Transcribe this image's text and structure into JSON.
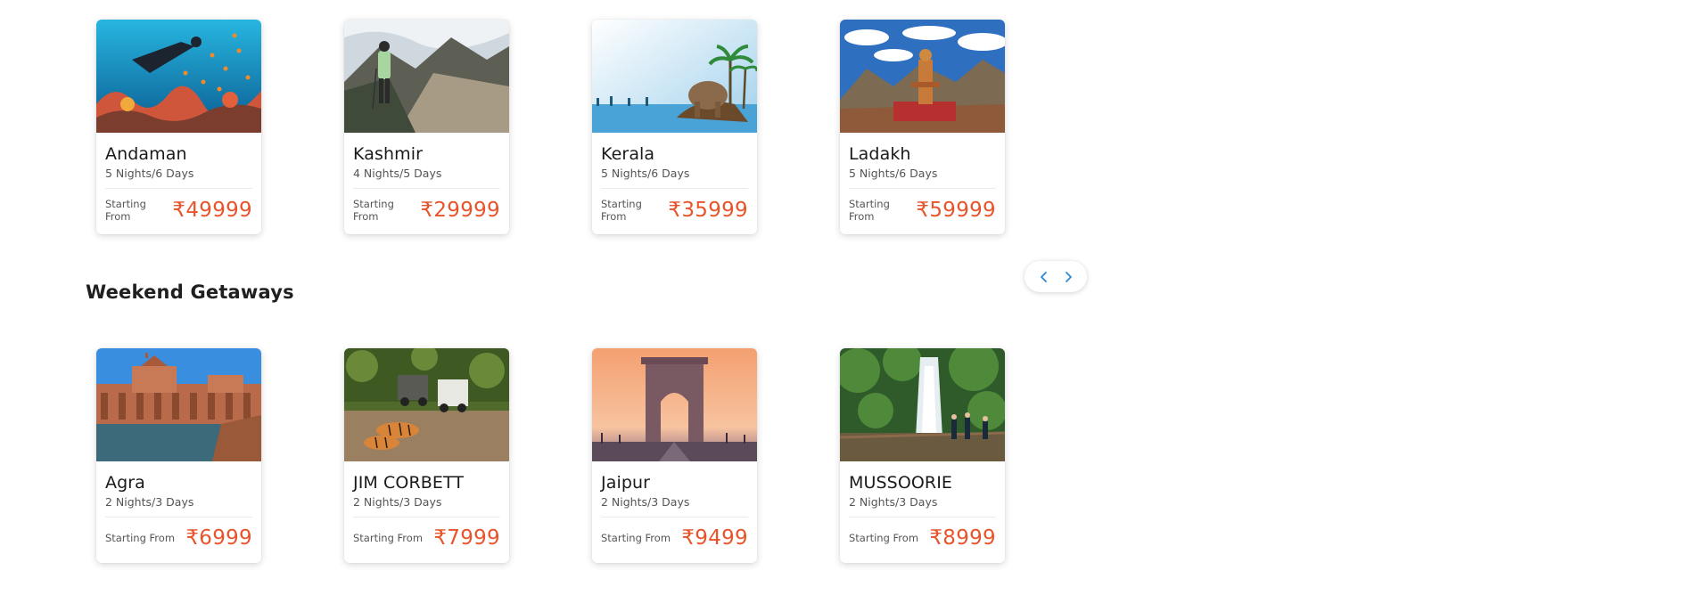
{
  "top_packages": [
    {
      "name": "Andaman",
      "duration": "5 Nights/6 Days",
      "price_label": "Starting From",
      "price": "₹49999",
      "image": "scuba-diving-reef"
    },
    {
      "name": "Kashmir",
      "duration": "4 Nights/5 Days",
      "price_label": "Starting From",
      "price": "₹29999",
      "image": "mountain-trekker"
    },
    {
      "name": "Kerala",
      "duration": "5 Nights/6 Days",
      "price_label": "Starting From",
      "price": "₹35999",
      "image": "elephant-palms-backwaters"
    },
    {
      "name": "Ladakh",
      "duration": "5 Nights/6 Days",
      "price_label": "Starting From",
      "price": "₹59999",
      "image": "statue-mountains"
    }
  ],
  "weekend_section": {
    "title": "Weekend Getaways",
    "packages": [
      {
        "name": "Agra",
        "duration": "2 Nights/3 Days",
        "price_label": "Starting From",
        "price": "₹6999",
        "image": "fatehpur-sikri"
      },
      {
        "name": "JIM CORBETT",
        "duration": "2 Nights/3 Days",
        "price_label": "Starting From",
        "price": "₹7999",
        "image": "tigers-jeeps"
      },
      {
        "name": "Jaipur",
        "duration": "2 Nights/3 Days",
        "price_label": "Starting From",
        "price": "₹9499",
        "image": "india-gate-sunset"
      },
      {
        "name": "MUSSOORIE",
        "duration": "2 Nights/3 Days",
        "price_label": "Starting From",
        "price": "₹8999",
        "image": "waterfall-forest"
      }
    ]
  },
  "carousel_nav": {
    "prev_icon": "chevron-left-icon",
    "next_icon": "chevron-right-icon",
    "color": "#2b8ad6"
  },
  "colors": {
    "price": "#e8542b",
    "title": "#1a1a1a"
  }
}
